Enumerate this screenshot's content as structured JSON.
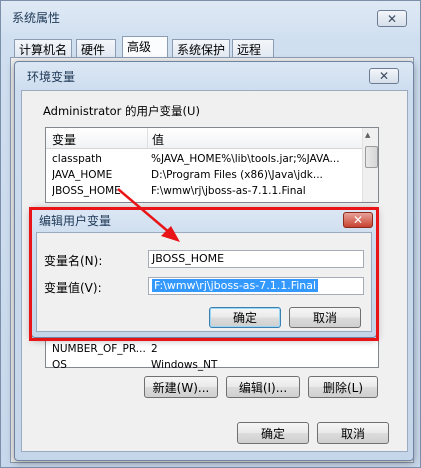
{
  "system_props": {
    "title": "系统属性",
    "tabs": [
      "计算机名",
      "硬件",
      "高级",
      "系统保护",
      "远程"
    ]
  },
  "env_dialog": {
    "title": "环境变量",
    "user_vars_label": "Administrator 的用户变量(U)",
    "columns": {
      "var": "变量",
      "value": "值"
    },
    "user_vars": [
      {
        "name": "classpath",
        "value": "%JAVA_HOME%\\lib\\tools.jar;%JAVA..."
      },
      {
        "name": "JAVA_HOME",
        "value": "D:\\Program Files (x86)\\Java\\jdk..."
      },
      {
        "name": "JBOSS_HOME",
        "value": "F:\\wmw\\rj\\jboss-as-7.1.1.Final"
      }
    ],
    "system_vars": [
      {
        "name": "NUMBER_OF_PR...",
        "value": "2"
      },
      {
        "name": "OS",
        "value": "Windows_NT"
      }
    ],
    "buttons": {
      "new": "新建(W)...",
      "edit": "编辑(I)...",
      "delete": "删除(L)"
    },
    "ok": "确定",
    "cancel": "取消"
  },
  "edit_dialog": {
    "title": "编辑用户变量",
    "name_label": "变量名(N):",
    "name_value": "JBOSS_HOME",
    "value_label": "变量值(V):",
    "value_value": "F:\\wmw\\rj\\jboss-as-7.1.1.Final",
    "ok": "确定",
    "cancel": "取消"
  },
  "colors": {
    "highlight_red": "#e81418",
    "selection": "#3399ff"
  }
}
